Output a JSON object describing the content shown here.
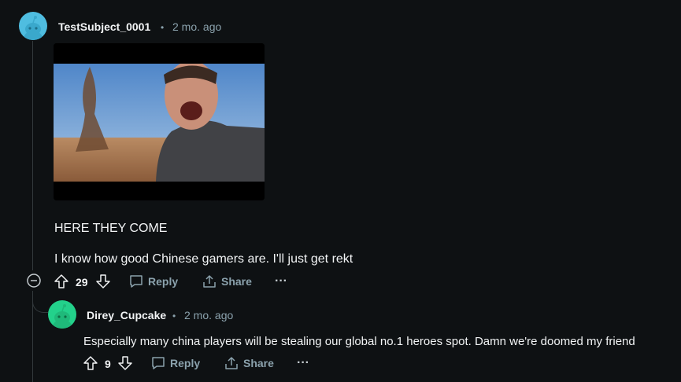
{
  "colors": {
    "background": "#0e1113",
    "text": "#f2f4f5",
    "muted": "#8ba2ad",
    "avatar1": "#4fbde0",
    "avatar2": "#23d18b"
  },
  "comment": {
    "username": "TestSubject_0001",
    "separator": "•",
    "time": "2 mo. ago",
    "media_alt": "man shouting in front of a dust devil",
    "line1": "HERE THEY COME",
    "line2": "I know how good Chinese gamers are. I'll just get rekt",
    "score": "29",
    "reply_label": "Reply",
    "share_label": "Share",
    "more_label": "···"
  },
  "reply": {
    "username": "Direy_Cupcake",
    "separator": "•",
    "time": "2 mo. ago",
    "text": "Especially many china players will be stealing our global no.1 heroes spot. Damn we're doomed my friend",
    "score": "9",
    "reply_label": "Reply",
    "share_label": "Share",
    "more_label": "···"
  }
}
